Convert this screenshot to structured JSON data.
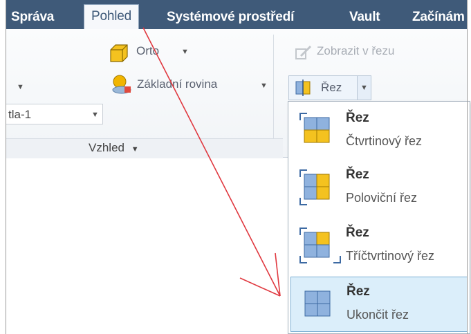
{
  "tabs": [
    {
      "label": "Správa",
      "active": false
    },
    {
      "label": "Pohled",
      "active": true
    },
    {
      "label": "Systémové prostředí",
      "active": false
    },
    {
      "label": "Vault",
      "active": false
    },
    {
      "label": "Začínám",
      "active": false
    }
  ],
  "ribbon": {
    "orto_label": "Orto",
    "zakladni_rovina_label": "Základní rovina",
    "zobrazit_v_rezu_label": "Zobrazit v řezu",
    "rez_label": "Řez",
    "dropdown_value": "tla-1",
    "panel_title": "Vzhled"
  },
  "menu": {
    "items": [
      {
        "title": "Řez",
        "subtitle": "Čtvrtinový řez"
      },
      {
        "title": "Řez",
        "subtitle": "Poloviční řez"
      },
      {
        "title": "Řez",
        "subtitle": "Tříčtvrtinový řez"
      },
      {
        "title": "Řez",
        "subtitle": "Ukončit řez",
        "selected": true
      }
    ]
  },
  "colors": {
    "tab_bar": "#3f5a79",
    "icon_yellow": "#f4c21f",
    "icon_blue": "#8fb2de",
    "annotation_arrow": "#e0383f",
    "selected_item": "#dbeefa"
  }
}
